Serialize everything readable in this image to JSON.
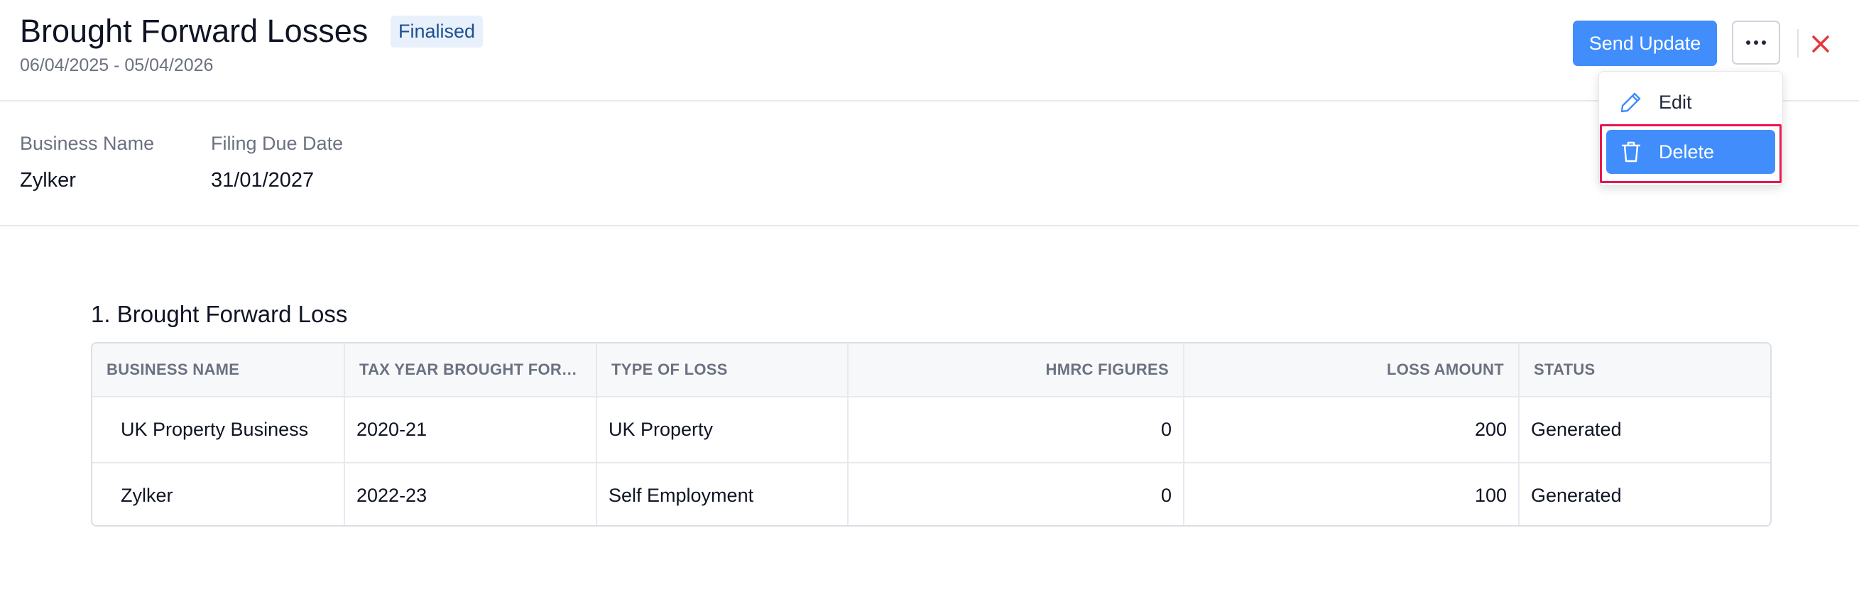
{
  "header": {
    "title": "Brought Forward Losses",
    "badge": "Finalised",
    "period": "06/04/2025 - 05/04/2026",
    "send_update_label": "Send Update"
  },
  "menu": {
    "items": [
      {
        "label": "Edit",
        "icon": "pencil-icon"
      },
      {
        "label": "Delete",
        "icon": "trash-icon"
      }
    ]
  },
  "info": {
    "business_name_label": "Business Name",
    "business_name_value": "Zylker",
    "filing_due_label": "Filing Due Date",
    "filing_due_value": "31/01/2027"
  },
  "section": {
    "title": "1. Brought Forward Loss"
  },
  "table": {
    "columns": [
      "BUSINESS NAME",
      "TAX YEAR BROUGHT FORW...",
      "TYPE OF LOSS",
      "HMRC FIGURES",
      "LOSS AMOUNT",
      "STATUS"
    ],
    "rows": [
      [
        "UK Property Business",
        "2020-21",
        "UK Property",
        "0",
        "200",
        "Generated"
      ],
      [
        "Zylker",
        "2022-23",
        "Self Employment",
        "0",
        "100",
        "Generated"
      ]
    ]
  },
  "colors": {
    "accent": "#408dfb",
    "highlight": "#e8184f",
    "close": "#e5383b"
  }
}
